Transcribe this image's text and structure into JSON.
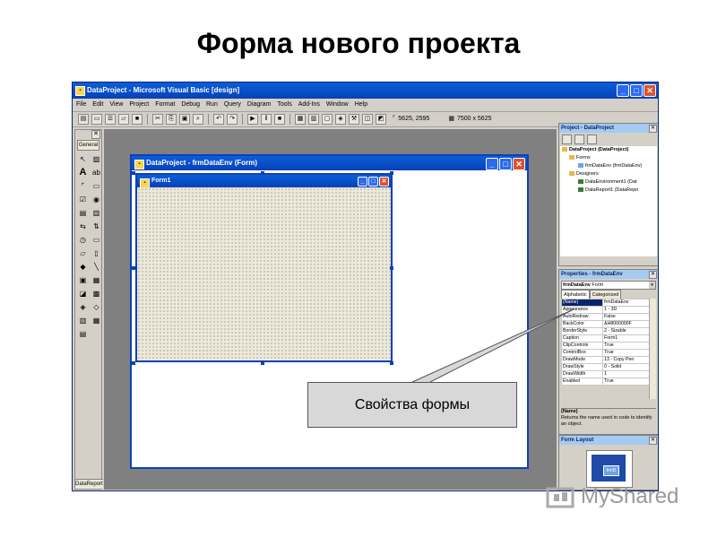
{
  "slide": {
    "title": "Форма нового проекта"
  },
  "app": {
    "title": "DataProject - Microsoft Visual Basic [design]",
    "menus": [
      "File",
      "Edit",
      "View",
      "Project",
      "Format",
      "Debug",
      "Run",
      "Query",
      "Diagram",
      "Tools",
      "Add-Ins",
      "Window",
      "Help"
    ],
    "toolbar": {
      "position": "5625, 2595",
      "size": "7500 x 5625"
    },
    "window_buttons": {
      "minimize": "_",
      "maximize": "□",
      "close": "✕"
    }
  },
  "toolbox": {
    "tab": "General",
    "close": "✕",
    "footer": "DataReport",
    "tools": [
      "pointer-tool",
      "picture-box-tool",
      "label-tool",
      "textbox-tool",
      "frame-tool",
      "command-button-tool",
      "checkbox-tool",
      "option-button-tool",
      "combobox-tool",
      "listbox-tool",
      "hscroll-tool",
      "vscroll-tool",
      "timer-tool",
      "drive-list-tool",
      "dir-list-tool",
      "file-list-tool",
      "shape-tool",
      "line-tool",
      "image-tool",
      "data-tool",
      "ole-tool",
      "grid-tool",
      "adodc-tool",
      "datalist-tool",
      "mschart-tool",
      "hflex-grid-tool",
      "extra-tool"
    ]
  },
  "designer": {
    "title": "DataProject - frmDataEnv (Form)",
    "form_title": "Form1"
  },
  "project_panel": {
    "title": "Project - DataProject",
    "tree": [
      {
        "label": "DataProject (DataProject)",
        "indent": 0
      },
      {
        "label": "Forms",
        "indent": 1
      },
      {
        "label": "frmDataEnv (frmDataEnv)",
        "indent": 2
      },
      {
        "label": "Designers",
        "indent": 1
      },
      {
        "label": "DataEnvironment1 (Dat",
        "indent": 2
      },
      {
        "label": "DataReport1 (DataRepo",
        "indent": 2
      }
    ]
  },
  "properties_panel": {
    "title": "Properties - frmDataEnv",
    "combo_name": "frmDataEnv",
    "combo_type": "Form",
    "tabs": [
      "Alphabetic",
      "Categorized"
    ],
    "rows": [
      [
        "(Name)",
        "frmDataEnv"
      ],
      [
        "Appearance",
        "1 - 3D"
      ],
      [
        "AutoRedraw",
        "False"
      ],
      [
        "BackColor",
        "&H8000000F"
      ],
      [
        "BorderStyle",
        "2 - Sizable"
      ],
      [
        "Caption",
        "Form1"
      ],
      [
        "ClipControls",
        "True"
      ],
      [
        "ControlBox",
        "True"
      ],
      [
        "DrawMode",
        "13 - Copy Pen"
      ],
      [
        "DrawStyle",
        "0 - Solid"
      ],
      [
        "DrawWidth",
        "1"
      ],
      [
        "Enabled",
        "True"
      ]
    ],
    "desc_title": "(Name)",
    "desc_text": "Returns the name used in code to identify an object."
  },
  "layout_panel": {
    "title": "Form Layout",
    "form_label": "frmD"
  },
  "callout": {
    "text": "Свойства формы"
  },
  "watermark": {
    "text": "MyShared"
  }
}
